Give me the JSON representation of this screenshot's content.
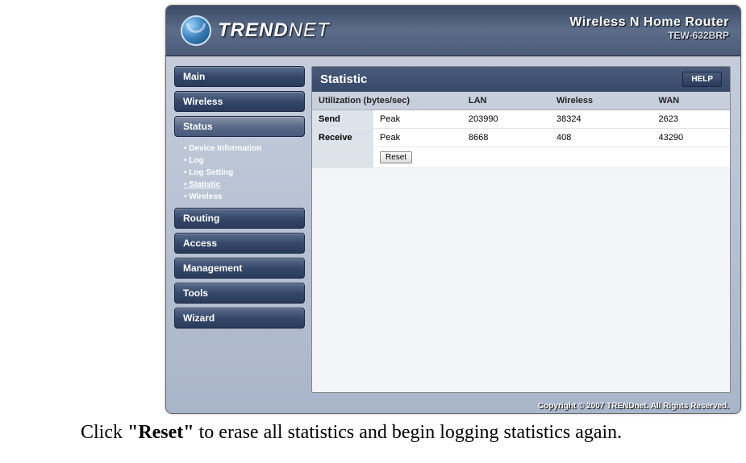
{
  "brand": {
    "name_bold": "TREND",
    "name_thin": "NET"
  },
  "header": {
    "product_name": "Wireless N Home Router",
    "product_model": "TEW-632BRP"
  },
  "nav": {
    "main": "Main",
    "wireless": "Wireless",
    "status": "Status",
    "routing": "Routing",
    "access": "Access",
    "management": "Management",
    "tools": "Tools",
    "wizard": "Wizard"
  },
  "subnav": {
    "device_info": "Device Information",
    "log": "Log",
    "log_setting": "Log Setting",
    "statistic": "Statistic",
    "wireless": "Wireless"
  },
  "content": {
    "title": "Statistic",
    "help": "HELP",
    "columns": {
      "util": "Utilization (bytes/sec)",
      "lan": "LAN",
      "wireless": "Wireless",
      "wan": "WAN"
    },
    "rows": {
      "send": {
        "label": "Send",
        "type": "Peak",
        "lan": "203990",
        "wireless": "38324",
        "wan": "2623"
      },
      "receive": {
        "label": "Receive",
        "type": "Peak",
        "lan": "8668",
        "wireless": "408",
        "wan": "43290"
      }
    },
    "reset_label": "Reset"
  },
  "footer": "Copyright © 2007 TRENDnet. All Rights Reserved.",
  "instruction": {
    "pre": "Click ",
    "bold": "\"Reset\"",
    "post": " to erase all statistics and begin logging statistics again."
  }
}
